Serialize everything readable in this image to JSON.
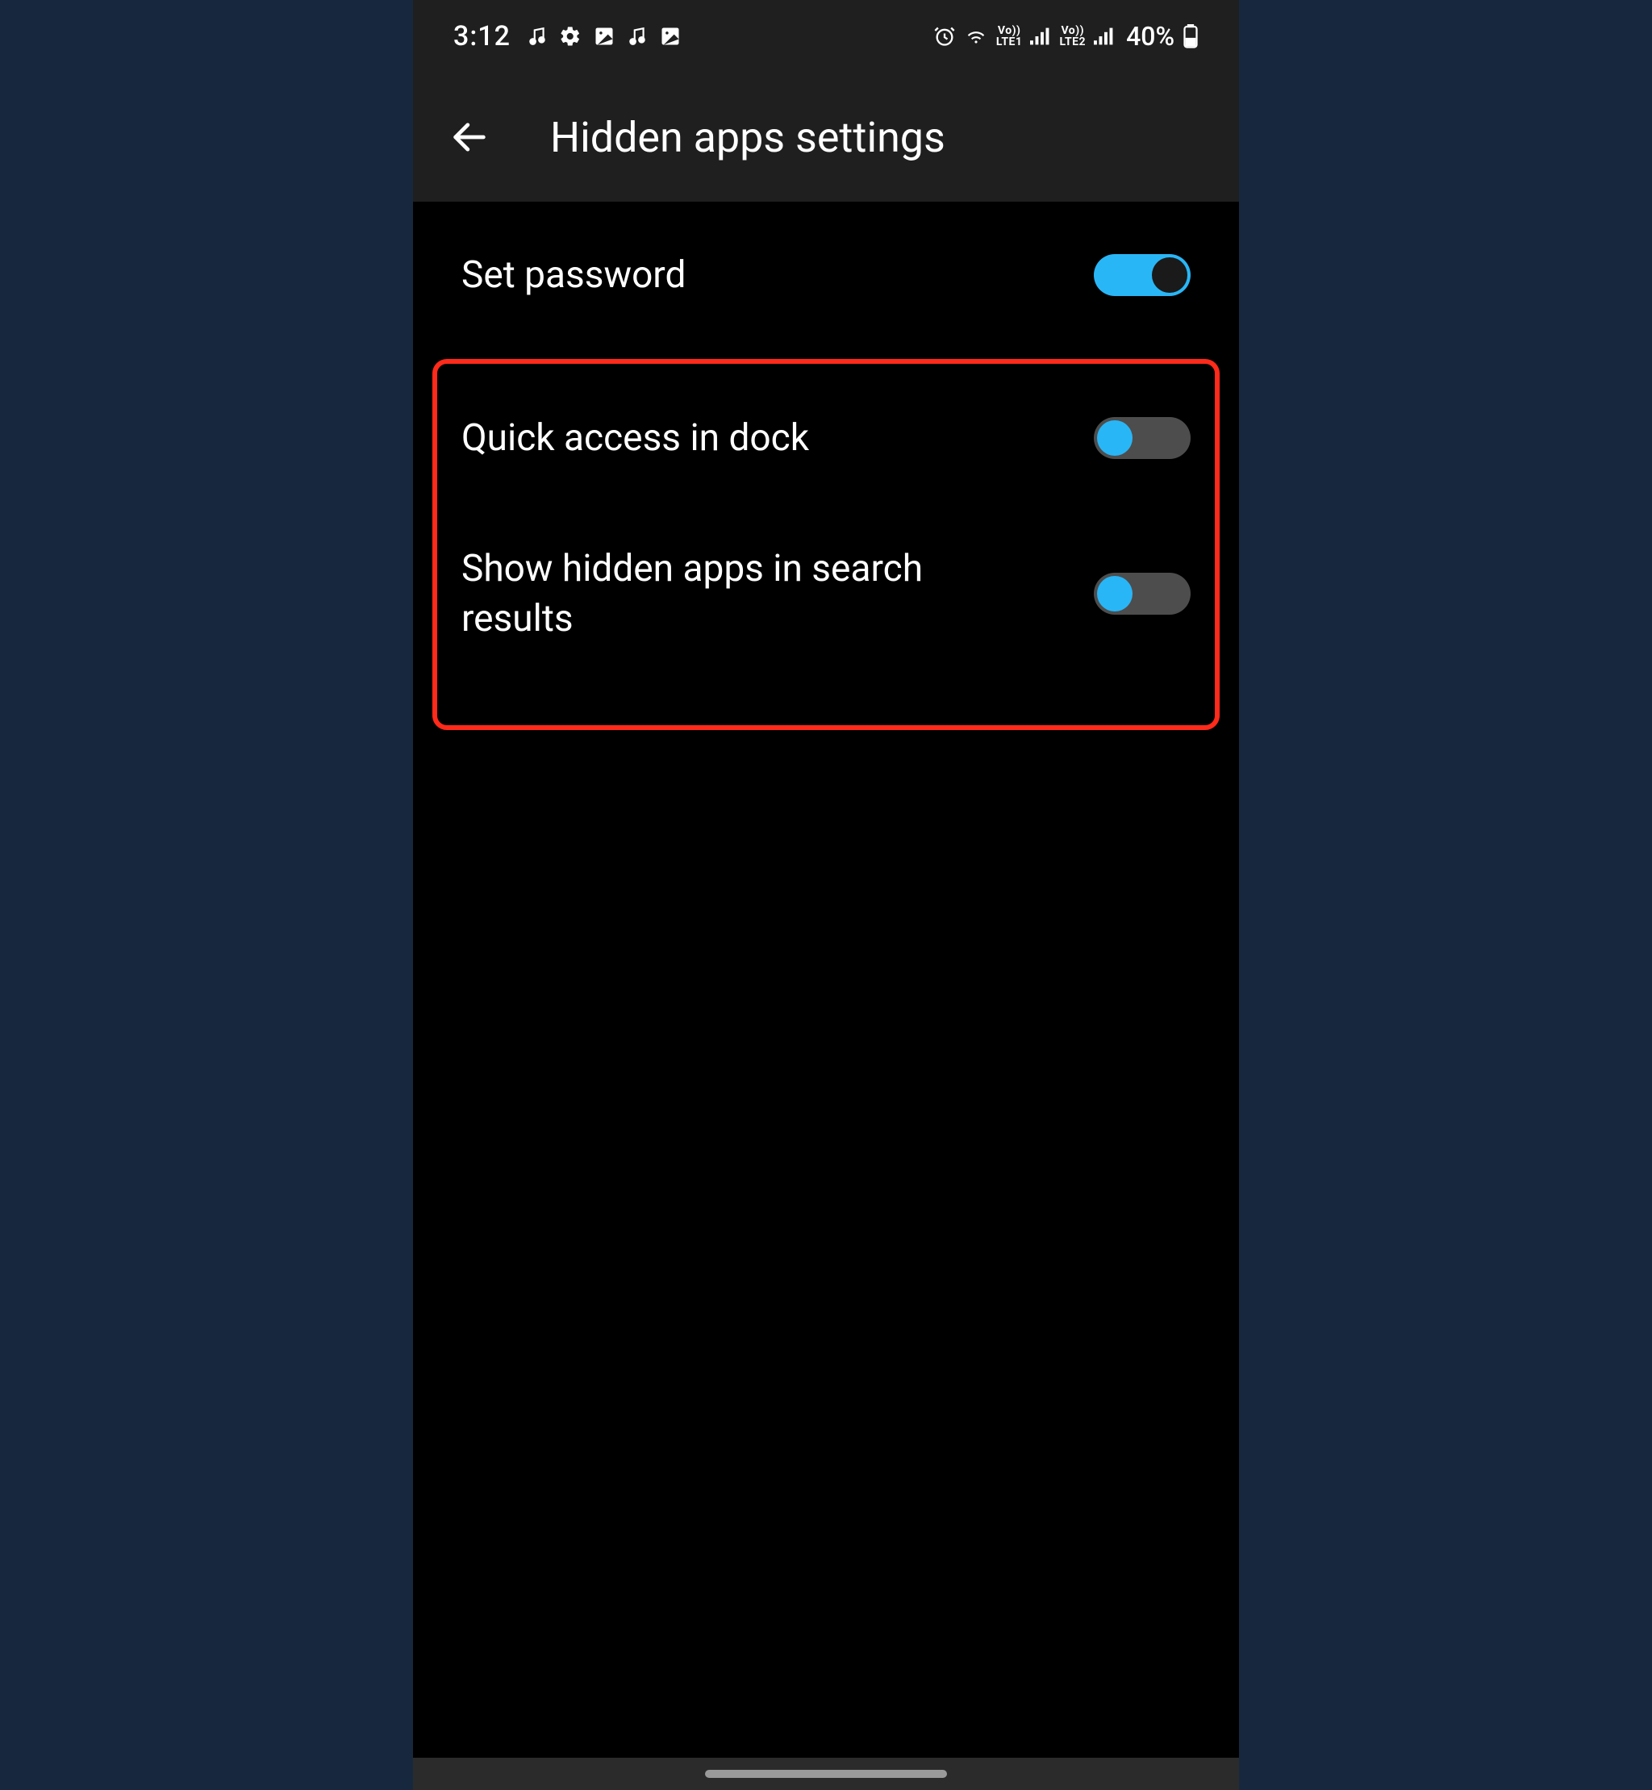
{
  "status_bar": {
    "time": "3:12",
    "battery_text": "40%",
    "lte1_top": "Vo))",
    "lte1_bot": "LTE1",
    "lte2_top": "Vo))",
    "lte2_bot": "LTE2"
  },
  "app_bar": {
    "title": "Hidden apps settings"
  },
  "settings": {
    "set_password": {
      "label": "Set password",
      "value": true,
      "toggle_style": "on-bright"
    },
    "quick_access": {
      "label": "Quick access in dock",
      "value": false,
      "toggle_style": "off-style"
    },
    "show_hidden_in_search": {
      "label": "Show hidden apps in search results",
      "value": false,
      "toggle_style": "off-style"
    }
  },
  "colors": {
    "accent": "#29b6f6",
    "highlight": "#ff2a1a"
  }
}
